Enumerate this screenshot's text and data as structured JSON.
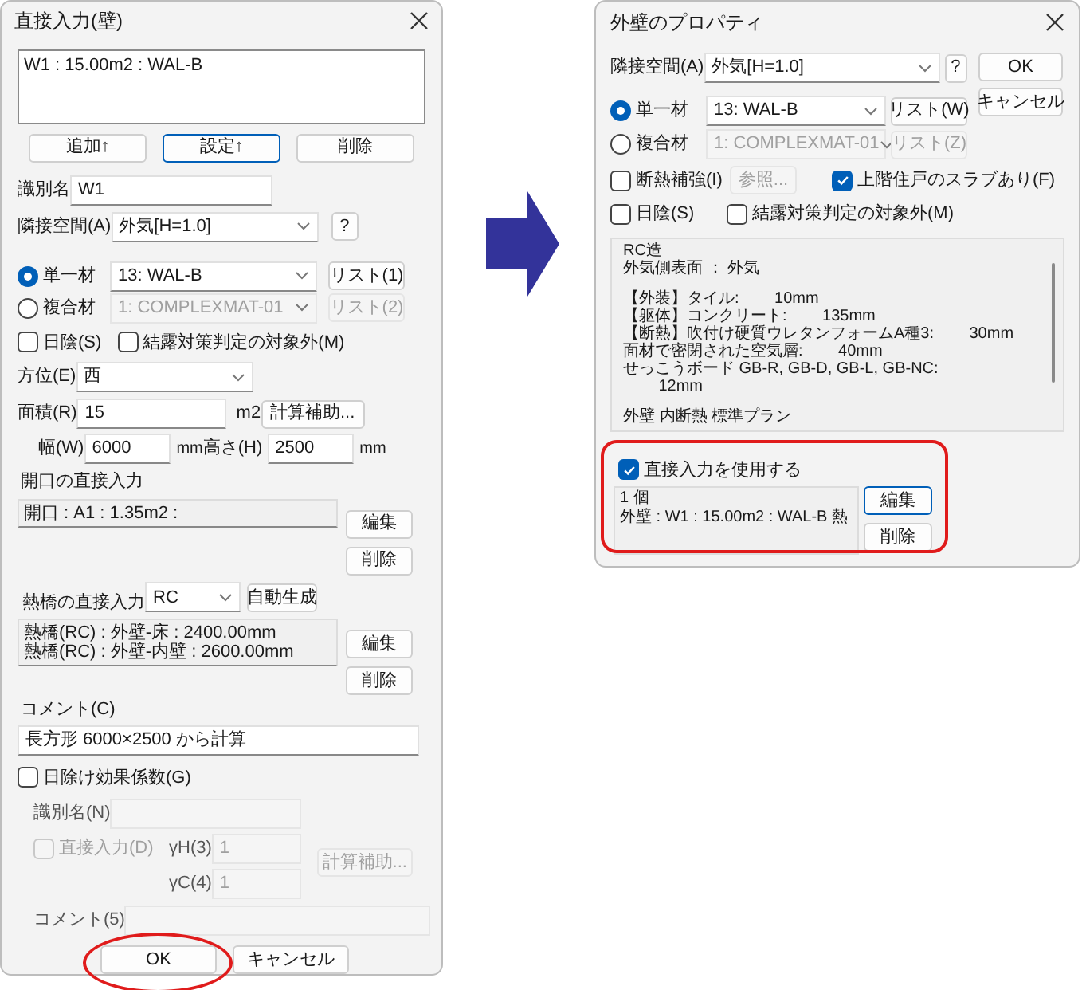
{
  "left_dialog": {
    "title": "直接入力(壁)",
    "list_items": [
      "W1 : 15.00m2 : WAL-B"
    ],
    "list_buttons": [
      {
        "label": "追加↑",
        "focused": false
      },
      {
        "label": "設定↑",
        "focused": true
      },
      {
        "label": "削除",
        "focused": false
      }
    ],
    "name_label": "識別名",
    "name_value": "W1",
    "adjacent_label": "隣接空間(A)",
    "adjacent_value": "外気[H=1.0]",
    "help_button": "?",
    "materials": [
      {
        "label": "単一材",
        "selected": true,
        "value": "13: WAL-B",
        "button": "リスト(1)"
      },
      {
        "label": "複合材",
        "selected": false,
        "value": "1: COMPLEXMAT-01",
        "button": "リスト(2)"
      }
    ],
    "checkboxes": [
      {
        "label": "日陰(S)",
        "checked": false
      },
      {
        "label": "結露対策判定の対象外(M)",
        "checked": false
      }
    ],
    "direction_label": "方位(E)",
    "direction_value": "西",
    "area_label": "面積(R)",
    "area_value": "15",
    "area_unit": "m2",
    "calc_button": "計算補助...",
    "width_label": "幅(W)",
    "width_value": "6000",
    "width_unit": "mm",
    "height_label": "高さ(H)",
    "height_value": "2500",
    "height_unit": "mm",
    "opening_label": "開口の直接入力",
    "opening_items": [
      "開口 : A1 : 1.35m2 :"
    ],
    "opening_buttons": [
      "編集",
      "削除"
    ],
    "thermal_label": "熱橋の直接入力",
    "thermal_type": "RC",
    "auto_button": "自動生成",
    "thermal_items": [
      "熱橋(RC) : 外壁-床 : 2400.00mm",
      "熱橋(RC) : 外壁-内壁 : 2600.00mm"
    ],
    "thermal_buttons": [
      "編集",
      "削除"
    ],
    "comment_label": "コメント(C)",
    "comment_value": "長方形 6000×2500 から計算",
    "shading": {
      "label": "日除け効果係数(G)",
      "checked": false,
      "name_label": "識別名(N)",
      "direct_label": "直接入力(D)",
      "direct_checked": false,
      "yh_label": "γH(3)",
      "yh_value": "1",
      "yc_label": "γC(4)",
      "yc_value": "1",
      "calc_button": "計算補助...",
      "comment_label": "コメント(5)"
    },
    "buttons": [
      {
        "label": "OK",
        "circled": true
      },
      {
        "label": "キャンセル",
        "circled": false
      }
    ]
  },
  "right_dialog": {
    "title": "外壁のプロパティ",
    "adjacent_label": "隣接空間(A)",
    "adjacent_value": "外気[H=1.0]",
    "help_button": "?",
    "buttons": [
      "OK",
      "キャンセル"
    ],
    "materials": [
      {
        "label": "単一材",
        "selected": true,
        "value": "13: WAL-B",
        "button": "リスト(W)"
      },
      {
        "label": "複合材",
        "selected": false,
        "value": "1: COMPLEXMAT-01",
        "button": "リスト(Z)"
      }
    ],
    "insulation": {
      "label": "断熱補強(I)",
      "checked": false,
      "button": "参照..."
    },
    "upper_slab": {
      "label": "上階住戸のスラブあり(F)",
      "checked": true
    },
    "shade": {
      "label": "日陰(S)",
      "checked": false
    },
    "condensation": {
      "label": "結露対策判定の対象外(M)",
      "checked": false
    },
    "description": [
      [
        "RC造",
        "外気側表面 ： 外気"
      ],
      [
        "【外装】タイル:        10mm",
        "【躯体】コンクリート:        135mm",
        "【断熱】吹付け硬質ウレタンフォームA種3:        30mm",
        "面材で密閉された空気層:        40mm",
        "せっこうボード GB-R, GB-D, GB-L, GB-NC:",
        "        12mm"
      ],
      [
        "外壁 内断熱 標準プラン"
      ]
    ],
    "direct_input": {
      "label": "直接入力を使用する",
      "checked": true,
      "lines": [
        "1 個",
        "外壁 : W1 : 15.00m2 : WAL-B 熱"
      ],
      "buttons": [
        "編集",
        "削除"
      ],
      "circled": true
    }
  }
}
